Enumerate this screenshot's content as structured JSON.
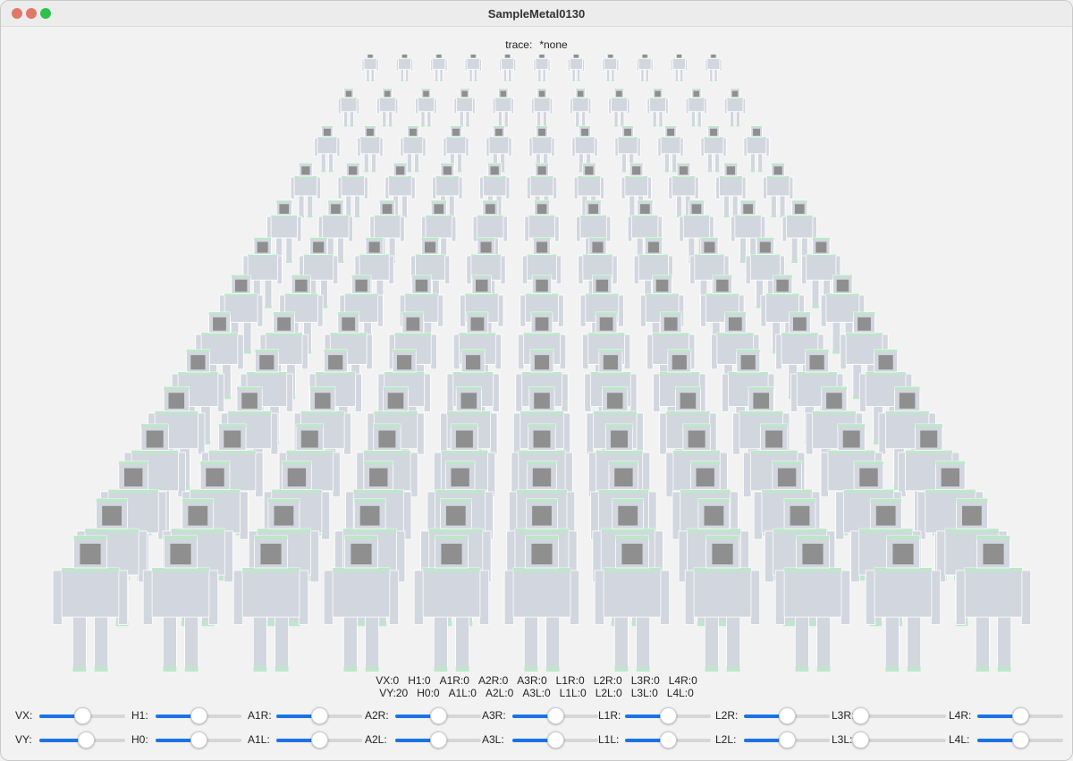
{
  "window": {
    "title": "SampleMetal0130",
    "controls": [
      "close",
      "minimize",
      "maximize"
    ]
  },
  "trace": {
    "label": "trace:",
    "value": "*none"
  },
  "scene": {
    "description_icon": "robot-crowd-render",
    "colors": {
      "body": "#d2d6df",
      "accent": "#bfe6cc",
      "face": "#8f8f8f",
      "outline": "#ffffff"
    }
  },
  "readout": {
    "row1": [
      "VX:0",
      "H1:0",
      "A1R:0",
      "A2R:0",
      "A3R:0",
      "L1R:0",
      "L2R:0",
      "L3R:0",
      "L4R:0"
    ],
    "row2": [
      "VY:20",
      "H0:0",
      "A1L:0",
      "A2L:0",
      "A3L:0",
      "L1L:0",
      "L2L:0",
      "L3L:0",
      "L4L:0"
    ]
  },
  "sliders": {
    "row1": [
      {
        "label": "VX:",
        "value": 0.5
      },
      {
        "label": "H1:",
        "value": 0.5
      },
      {
        "label": "A1R:",
        "value": 0.5
      },
      {
        "label": "A2R:",
        "value": 0.5
      },
      {
        "label": "A3R:",
        "value": 0.5
      },
      {
        "label": "L1R:",
        "value": 0.5
      },
      {
        "label": "L2R:",
        "value": 0.5
      },
      {
        "label": "L3R:",
        "value": 0.0
      },
      {
        "label": "L4R:",
        "value": 0.5
      }
    ],
    "row2": [
      {
        "label": "VY:",
        "value": 0.55
      },
      {
        "label": "H0:",
        "value": 0.5
      },
      {
        "label": "A1L:",
        "value": 0.5
      },
      {
        "label": "A2L:",
        "value": 0.5
      },
      {
        "label": "A3L:",
        "value": 0.5
      },
      {
        "label": "L1L:",
        "value": 0.5
      },
      {
        "label": "L2L:",
        "value": 0.5
      },
      {
        "label": "L3L:",
        "value": 0.0
      },
      {
        "label": "L4L:",
        "value": 0.5
      }
    ]
  },
  "accent_color": "#1a73e8"
}
